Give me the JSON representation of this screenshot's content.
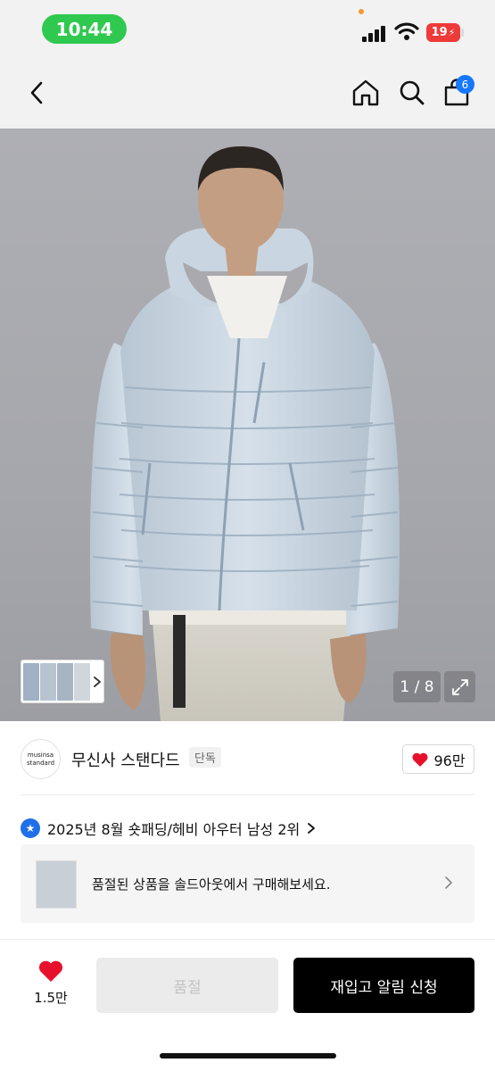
{
  "status_bar": {
    "time": "10:44",
    "battery": "19"
  },
  "header": {
    "cart_count": "6",
    "icons": [
      "back-arrow-icon",
      "home-icon",
      "search-icon",
      "shopping-bag-icon"
    ]
  },
  "gallery": {
    "counter": "1 / 8",
    "current_index": 1,
    "total": 8,
    "image_description": "",
    "thumbnails": [
      "jacket-front",
      "jacket-side",
      "jacket-back"
    ]
  },
  "brand": {
    "logo_line1": "musinsa",
    "logo_line2": "standard",
    "name": "무신사 스탠다드",
    "tag": "단독",
    "likes": "96만"
  },
  "ranking": {
    "text": "2025년 8월 숏패딩/헤비 아우터 남성 2위"
  },
  "soldout_banner": {
    "text": "품절된 상품을 솔드아웃에서 구매해보세요."
  },
  "bottom_bar": {
    "wish_count": "1.5만",
    "soldout_label": "품절",
    "restock_label": "재입고 알림 신청"
  },
  "colors": {
    "accent_blue": "#1677ff",
    "heart_red": "#e8112d",
    "time_green": "#2fc94f",
    "battery_red": "#ef3a3a",
    "black": "#000000"
  }
}
